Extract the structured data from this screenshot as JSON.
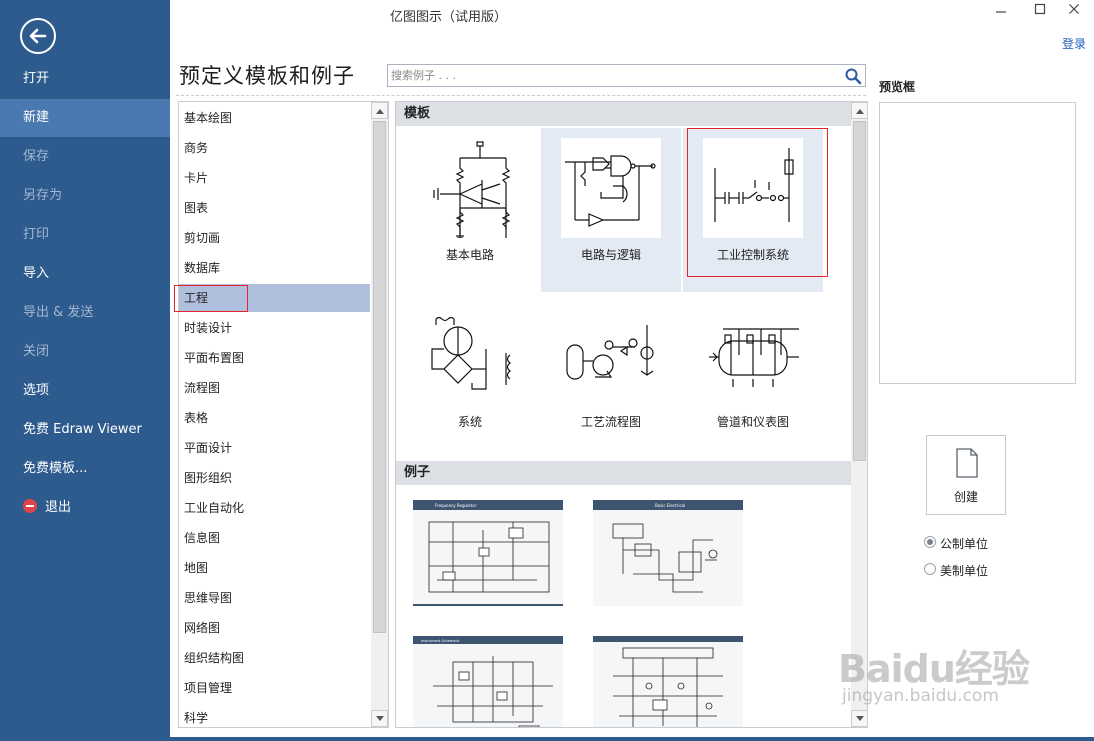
{
  "app": {
    "title": "亿图图示（试用版）",
    "login": "登录",
    "window_controls": [
      "minimize-icon",
      "maximize-icon",
      "close-icon"
    ]
  },
  "sidebar": {
    "back_icon": "back-arrow-icon",
    "items": [
      {
        "label": "打开",
        "state": "normal"
      },
      {
        "label": "新建",
        "state": "active"
      },
      {
        "label": "保存",
        "state": "disabled"
      },
      {
        "label": "另存为",
        "state": "disabled"
      },
      {
        "label": "打印",
        "state": "disabled"
      },
      {
        "label": "导入",
        "state": "normal"
      },
      {
        "label": "导出 & 发送",
        "state": "disabled"
      },
      {
        "label": "关闭",
        "state": "disabled"
      },
      {
        "label": "选项",
        "state": "normal"
      },
      {
        "label": "免费 Edraw Viewer",
        "state": "normal"
      },
      {
        "label": "免费模板...",
        "state": "normal"
      },
      {
        "label": "退出",
        "state": "normal",
        "icon": "exit-icon"
      }
    ]
  },
  "main": {
    "title": "预定义模板和例子",
    "search": {
      "placeholder": "搜索例子 . . .",
      "value": "",
      "icon": "search-icon"
    }
  },
  "categories": {
    "selected": "工程",
    "items": [
      "基本绘图",
      "商务",
      "卡片",
      "图表",
      "剪切画",
      "数据库",
      "工程",
      "时装设计",
      "平面布置图",
      "流程图",
      "表格",
      "平面设计",
      "图形组织",
      "工业自动化",
      "信息图",
      "地图",
      "思维导图",
      "网络图",
      "组织结构图",
      "项目管理",
      "科学"
    ]
  },
  "templates": {
    "header": "模板",
    "items": [
      {
        "label": "基本电路",
        "highlighted": false
      },
      {
        "label": "电路与逻辑",
        "highlighted": true
      },
      {
        "label": "工业控制系统",
        "highlighted": true
      },
      {
        "label": "系统",
        "highlighted": false
      },
      {
        "label": "工艺流程图",
        "highlighted": false
      },
      {
        "label": "管道和仪表图",
        "highlighted": false
      }
    ]
  },
  "examples": {
    "header": "例子",
    "items": [
      {
        "caption": "Frequency Regulator"
      },
      {
        "caption": "Basic Electrical"
      },
      {
        "caption": "Instrument Schematic"
      },
      {
        "caption": ""
      }
    ]
  },
  "preview": {
    "label": "预览框",
    "create_label": "创建",
    "create_icon": "document-icon",
    "units": [
      {
        "label": "公制单位",
        "selected": true
      },
      {
        "label": "美制单位",
        "selected": false
      }
    ]
  },
  "watermark": {
    "brand": "Baidu经验",
    "domain": "jingyan.baidu.com"
  },
  "colors": {
    "sidebar": "#2e5b8e",
    "sidebar_active": "#4a78b0",
    "selection": "#b0bfde",
    "highlight_border": "#e4262b",
    "link": "#1c5fbf"
  }
}
